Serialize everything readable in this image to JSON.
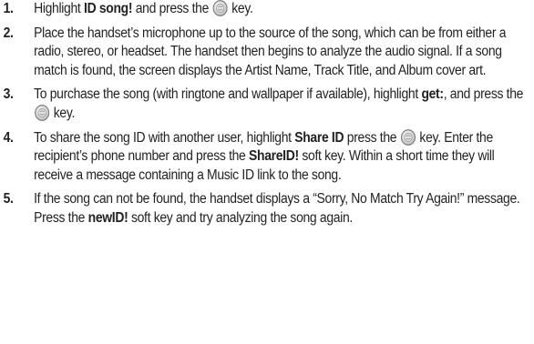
{
  "steps": [
    {
      "number": "1.",
      "t1": "Highlight ",
      "b1": "ID song!",
      "t2": " and press the ",
      "icon": "ok-key-icon",
      "t3": " key."
    },
    {
      "number": "2.",
      "text": "Place the handset’s microphone up to the source of the song, which can be from either a radio, stereo, or headset. The handset then begins to analyze the audio signal. If a song match is found, the screen displays the Artist Name, Track Title, and Album cover art."
    },
    {
      "number": "3.",
      "t1": "To purchase the song (with ringtone and wallpaper if available), highlight ",
      "b1": "get:",
      "t2": ", and press the ",
      "icon": "ok-key-icon",
      "t3": " key."
    },
    {
      "number": "4.",
      "t1": "To share the song ID with another user, highlight ",
      "b1": "Share ID",
      "t2": " press the ",
      "icon": "ok-key-icon",
      "t3": " key. Enter the recipient’s phone number and press the ",
      "b2": "ShareID!",
      "t4": " soft key. Within a short time they will receive a message containing a Music ID link to the song."
    },
    {
      "number": "5.",
      "t1": "If the song can not be found, the handset displays a “Sorry, No Match Try Again!” message. Press the ",
      "b1": "newID!",
      "t2": " soft key and try analyzing the song again."
    }
  ],
  "colors": {
    "text": "#222222",
    "key_outer": "#8a8a8a",
    "key_inner": "#d4d4d4"
  }
}
